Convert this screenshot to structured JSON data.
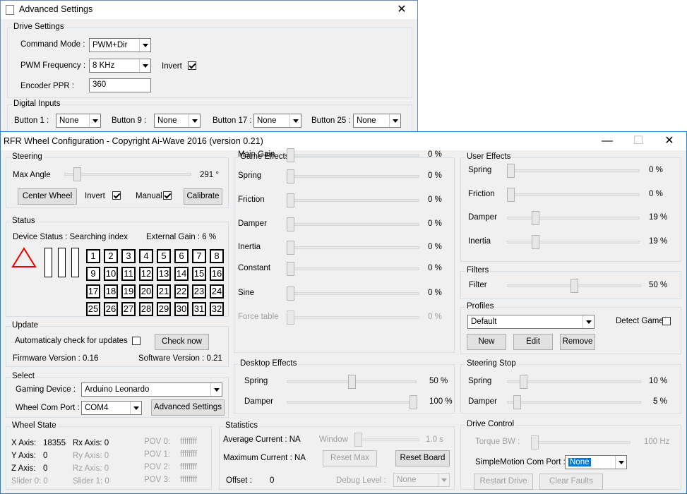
{
  "adv": {
    "title": "Advanced Settings",
    "drive_title": "Drive Settings",
    "cmd_label": "Command Mode :",
    "cmd_value": "PWM+Dir",
    "pwm_label": "PWM Frequency :",
    "pwm_value": "8 KHz",
    "invert_label": "Invert",
    "encoder_label": "Encoder PPR :",
    "encoder_value": "360",
    "digital_title": "Digital Inputs",
    "buttons": [
      {
        "label": "Button  1 :",
        "value": "None"
      },
      {
        "label": "Button  9 :",
        "value": "None"
      },
      {
        "label": "Button 17 :",
        "value": "None"
      },
      {
        "label": "Button 25 :",
        "value": "None"
      }
    ]
  },
  "main": {
    "title": "RFR Wheel Configuration - Copyright Ai-Wave 2016 (version 0.21)",
    "steering": {
      "title": "Steering",
      "max_angle_label": "Max Angle",
      "max_angle_value": "291 °",
      "max_angle_fraction": 0.08,
      "center_wheel": "Center Wheel",
      "invert": "Invert",
      "manual": "Manual",
      "calibrate": "Calibrate"
    },
    "status": {
      "title": "Status",
      "device_status": "Device Status :  Searching index",
      "external_gain": "External Gain :  6 %",
      "buttons": [
        "1",
        "2",
        "3",
        "4",
        "5",
        "6",
        "7",
        "8",
        "9",
        "10",
        "11",
        "12",
        "13",
        "14",
        "15",
        "16",
        "17",
        "18",
        "19",
        "20",
        "21",
        "22",
        "23",
        "24",
        "25",
        "26",
        "27",
        "28",
        "29",
        "30",
        "31",
        "32"
      ]
    },
    "update": {
      "title": "Update",
      "auto_check": "Automaticaly check for updates",
      "check_now": "Check now",
      "firmware": "Firmware Version :  0.16",
      "software": "Software Version :    0.21"
    },
    "select": {
      "title": "Select",
      "gaming_device_label": "Gaming Device :",
      "gaming_device_value": "Arduino Leonardo",
      "com_port_label": "Wheel Com Port :",
      "com_port_value": "COM4",
      "advanced_settings": "Advanced Settings"
    },
    "wheel_state": {
      "title": "Wheel State",
      "x_axis": "X Axis:",
      "x_value": "18355",
      "y_axis": "Y Axis:",
      "y_value": "0",
      "z_axis": "Z Axis:",
      "z_value": "0",
      "slider0": "Slider 0:  0",
      "rx": "Rx Axis:  0",
      "ry": "Ry Axis:  0",
      "rz": "Rz Axis:  0",
      "slider1": "Slider 1:  0",
      "pov0": "POV 0:",
      "pov1": "POV 1:",
      "pov2": "POV 2:",
      "pov3": "POV 3:",
      "pov_value": "ffffffff"
    },
    "game_effects": {
      "title": "Game Effects",
      "rows": [
        {
          "label": "Main Gain",
          "value": "0 %"
        },
        {
          "label": "Spring",
          "value": "0 %"
        },
        {
          "label": "Friction",
          "value": "0 %"
        },
        {
          "label": "Damper",
          "value": "0 %"
        },
        {
          "label": "Inertia",
          "value": "0 %"
        },
        {
          "label": "Constant",
          "value": "0 %"
        },
        {
          "label": "Sine",
          "value": "0 %"
        },
        {
          "label": "Force table",
          "value": "0 %"
        }
      ]
    },
    "desktop_effects": {
      "title": "Desktop Effects",
      "spring_label": "Spring",
      "spring_value": "50 %",
      "spring_fraction": 0.5,
      "damper_label": "Damper",
      "damper_value": "100 %",
      "damper_fraction": 1.0
    },
    "statistics": {
      "title": "Statistics",
      "avg_current": "Average Current :   NA",
      "window": "Window",
      "window_value": "1.0 s",
      "max_current": "Maximum Current :   NA",
      "reset_max": "Reset Max",
      "reset_board": "Reset Board",
      "offset": "Offset :",
      "offset_value": "0",
      "debug_level": "Debug Level :",
      "debug_value": "None"
    },
    "user_effects": {
      "title": "User Effects",
      "rows": [
        {
          "label": "Spring",
          "value": "0 %",
          "fraction": 0
        },
        {
          "label": "Friction",
          "value": "0 %",
          "fraction": 0
        },
        {
          "label": "Damper",
          "value": "19 %",
          "fraction": 0.19
        },
        {
          "label": "Inertia",
          "value": "19 %",
          "fraction": 0.19
        }
      ]
    },
    "filters": {
      "title": "Filters",
      "filter_label": "Filter",
      "filter_value": "50 %",
      "filter_fraction": 0.5
    },
    "profiles": {
      "title": "Profiles",
      "profile_value": "Default",
      "detect_game": "Detect Game",
      "new": "New",
      "edit": "Edit",
      "remove": "Remove"
    },
    "steering_stop": {
      "title": "Steering Stop",
      "spring_label": "Spring",
      "spring_value": "10 %",
      "spring_fraction": 0.1,
      "damper_label": "Damper",
      "damper_value": "5 %",
      "damper_fraction": 0.05
    },
    "drive_control": {
      "title": "Drive Control",
      "torque_bw": "Torque BW :",
      "torque_value": "100 Hz",
      "simplemotion_label": "SimpleMotion Com Port :",
      "simplemotion_value": "None",
      "restart_drive": "Restart Drive",
      "clear_faults": "Clear Faults"
    }
  }
}
